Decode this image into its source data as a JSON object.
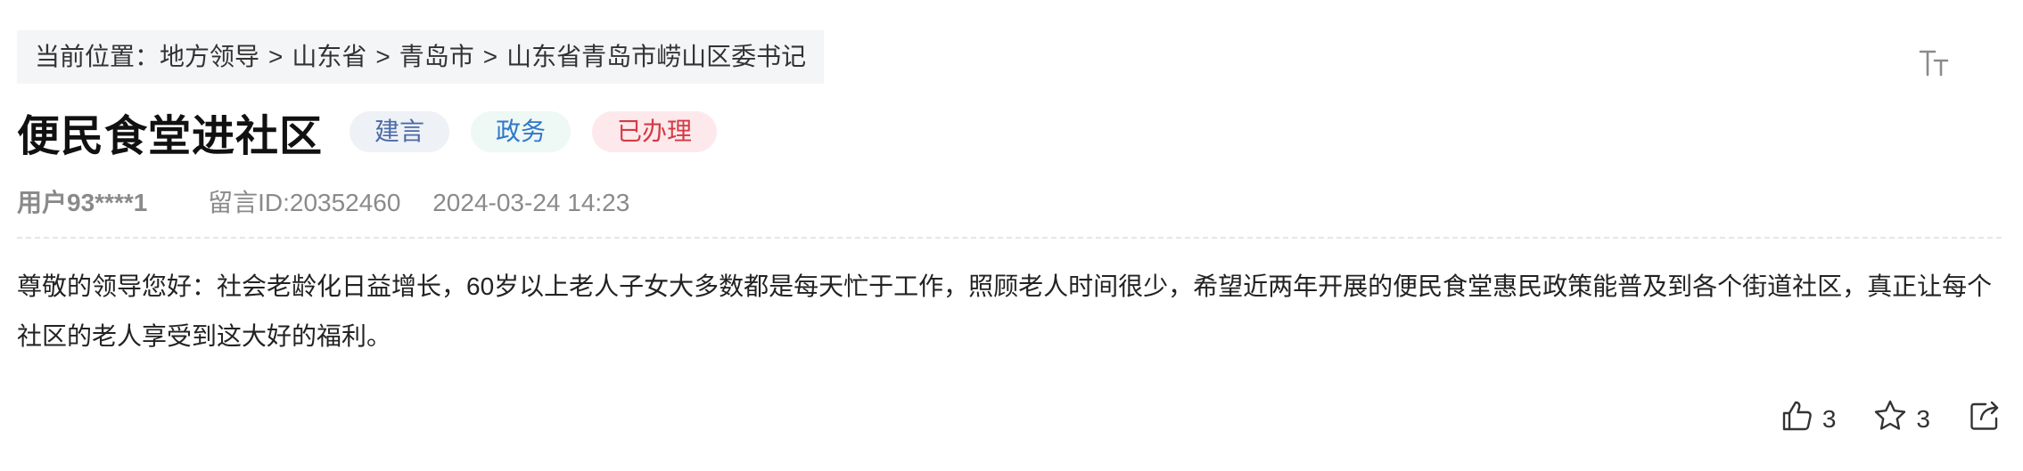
{
  "breadcrumb": {
    "prefix": "当前位置：",
    "items": [
      "地方领导",
      "山东省",
      "青岛市",
      "山东省青岛市崂山区委书记"
    ],
    "separator": ">"
  },
  "header": {
    "title": "便民食堂进社区",
    "tags": {
      "type": "建言",
      "category": "政务",
      "status": "已办理"
    }
  },
  "meta": {
    "user": "用户93****1",
    "message_id": "留言ID:20352460",
    "time": "2024-03-24 14:23"
  },
  "content": "尊敬的领导您好：社会老龄化日益增长，60岁以上老人子女大多数都是每天忙于工作，照顾老人时间很少，希望近两年开展的便民食堂惠民政策能普及到各个街道社区，真正让每个社区的老人享受到这大好的福利。",
  "actions": {
    "like_count": "3",
    "favorite_count": "3"
  },
  "icons": {
    "font_size": "font-size-icon",
    "like": "thumbs-up-icon",
    "favorite": "star-icon",
    "share": "share-icon"
  },
  "colors": {
    "tag_type_text": "#4b6aa8",
    "tag_category_text": "#2f78c8",
    "tag_status_text": "#d43a44",
    "meta_text": "#8a8a8a"
  }
}
